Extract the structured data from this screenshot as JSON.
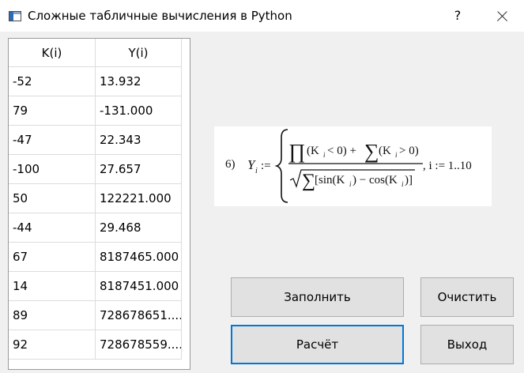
{
  "window": {
    "title": "Сложные табличные вычисления в Python",
    "help_label": "?"
  },
  "table": {
    "headers": [
      "K(i)",
      "Y(i)"
    ],
    "rows": [
      [
        "-52",
        "13.932"
      ],
      [
        "79",
        "-131.000"
      ],
      [
        "-47",
        "22.343"
      ],
      [
        "-100",
        "27.657"
      ],
      [
        "50",
        "122221.000"
      ],
      [
        "-44",
        "29.468"
      ],
      [
        "67",
        "8187465.000"
      ],
      [
        "14",
        "8187451.000"
      ],
      [
        "89",
        "728678651...."
      ],
      [
        "92",
        "728678559...."
      ]
    ]
  },
  "formula": {
    "number": "6)",
    "y": "Y",
    "i_sub": "i",
    "assign": ":=",
    "num_k1": "(K",
    "num_cond1": " < 0) +",
    "num_k2": "(K",
    "num_cond2": " > 0)",
    "den_text": "[sin(K",
    "den_mid": ") − cos(K",
    "den_end": ")]",
    "range": ", i := 1..10"
  },
  "buttons": {
    "fill": "Заполнить",
    "clear": "Очистить",
    "calc": "Расчёт",
    "exit": "Выход"
  }
}
